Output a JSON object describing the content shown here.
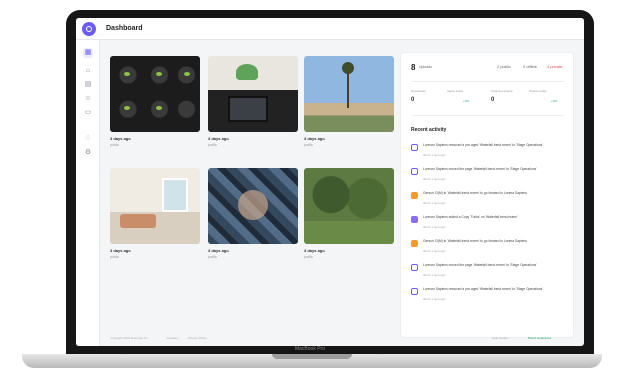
{
  "app": {
    "title": "Dashboard",
    "device_label": "MacBook Pro"
  },
  "sidebar": {
    "items": [
      {
        "icon": "grid-icon"
      },
      {
        "icon": "home-icon"
      },
      {
        "icon": "calendar-icon"
      },
      {
        "icon": "people-icon"
      },
      {
        "icon": "document-icon"
      },
      {
        "icon": "bell-icon"
      },
      {
        "icon": "gear-icon"
      }
    ]
  },
  "media": [
    {
      "caption": "3 days ago",
      "sub": "public"
    },
    {
      "caption": "3 days ago",
      "sub": "public"
    },
    {
      "caption": "3 days ago",
      "sub": "public"
    },
    {
      "caption": "3 days ago",
      "sub": "public"
    },
    {
      "caption": "3 days ago",
      "sub": "public"
    },
    {
      "caption": "3 days ago",
      "sub": "public"
    }
  ],
  "stats": {
    "count": "8",
    "count_label": "Uploads",
    "right": [
      "2 public",
      "0 offline",
      "4 private"
    ],
    "mini": [
      {
        "label": "Downloads",
        "value": "0"
      },
      {
        "label": "Views today",
        "tag": "+0%"
      },
      {
        "label": "Total Comments",
        "value": "0"
      },
      {
        "label": "Shares today",
        "tag": "+0%"
      }
    ]
  },
  "activity": {
    "title": "Recent activity",
    "items": [
      {
        "text": "Lorenzo Sapiens removed a pre-aged 'Waterfall trend.rearm' to 'Stage Operations'",
        "time": "about 1 hour ago",
        "color": "#6b5cf6"
      },
      {
        "text": "Lorenzo Sapiens moved the page 'Waterfall trend.rearm' to 'Stage Operations'",
        "time": "about 1 hour ago",
        "color": "#6b5cf6"
      },
      {
        "text": "Gerson Cl(M) in 'Waterfall trend.rearm' to go forward in Lorena Sapiens",
        "time": "about 1 hour ago",
        "color": "#f39a2b"
      },
      {
        "text": "Lorenzo Sapiens added a Copy 'Tricks' on 'Waterfall trend.rearm'",
        "time": "about 1 hour ago",
        "color": "#8b6cf6"
      },
      {
        "text": "Gerson Cl(M) in 'Waterfall trend.rearm' to go forward in Lorena Sapiens",
        "time": "about 1 hour ago",
        "color": "#f39a2b"
      },
      {
        "text": "Lorenzo Sapiens moved the page 'Waterfall trend.rearm' to 'Stage Operations'",
        "time": "about 1 hour ago",
        "color": "#6b5cf6"
      },
      {
        "text": "Lorenzo Sapiens removed a pre-aged 'Waterfall trend.rearm' to 'Stage Operations'",
        "time": "about 1 hour ago",
        "color": "#6b5cf6"
      }
    ]
  },
  "footer": {
    "left": [
      "Copyright 2024 Example Inc",
      "Company",
      "Privacy Policy"
    ],
    "right": [
      "Help Center",
      "Brand Guidelines"
    ]
  },
  "colors": {
    "accent": "#6b5cf6",
    "success": "#2aa56a",
    "warning": "#f39a2b"
  }
}
